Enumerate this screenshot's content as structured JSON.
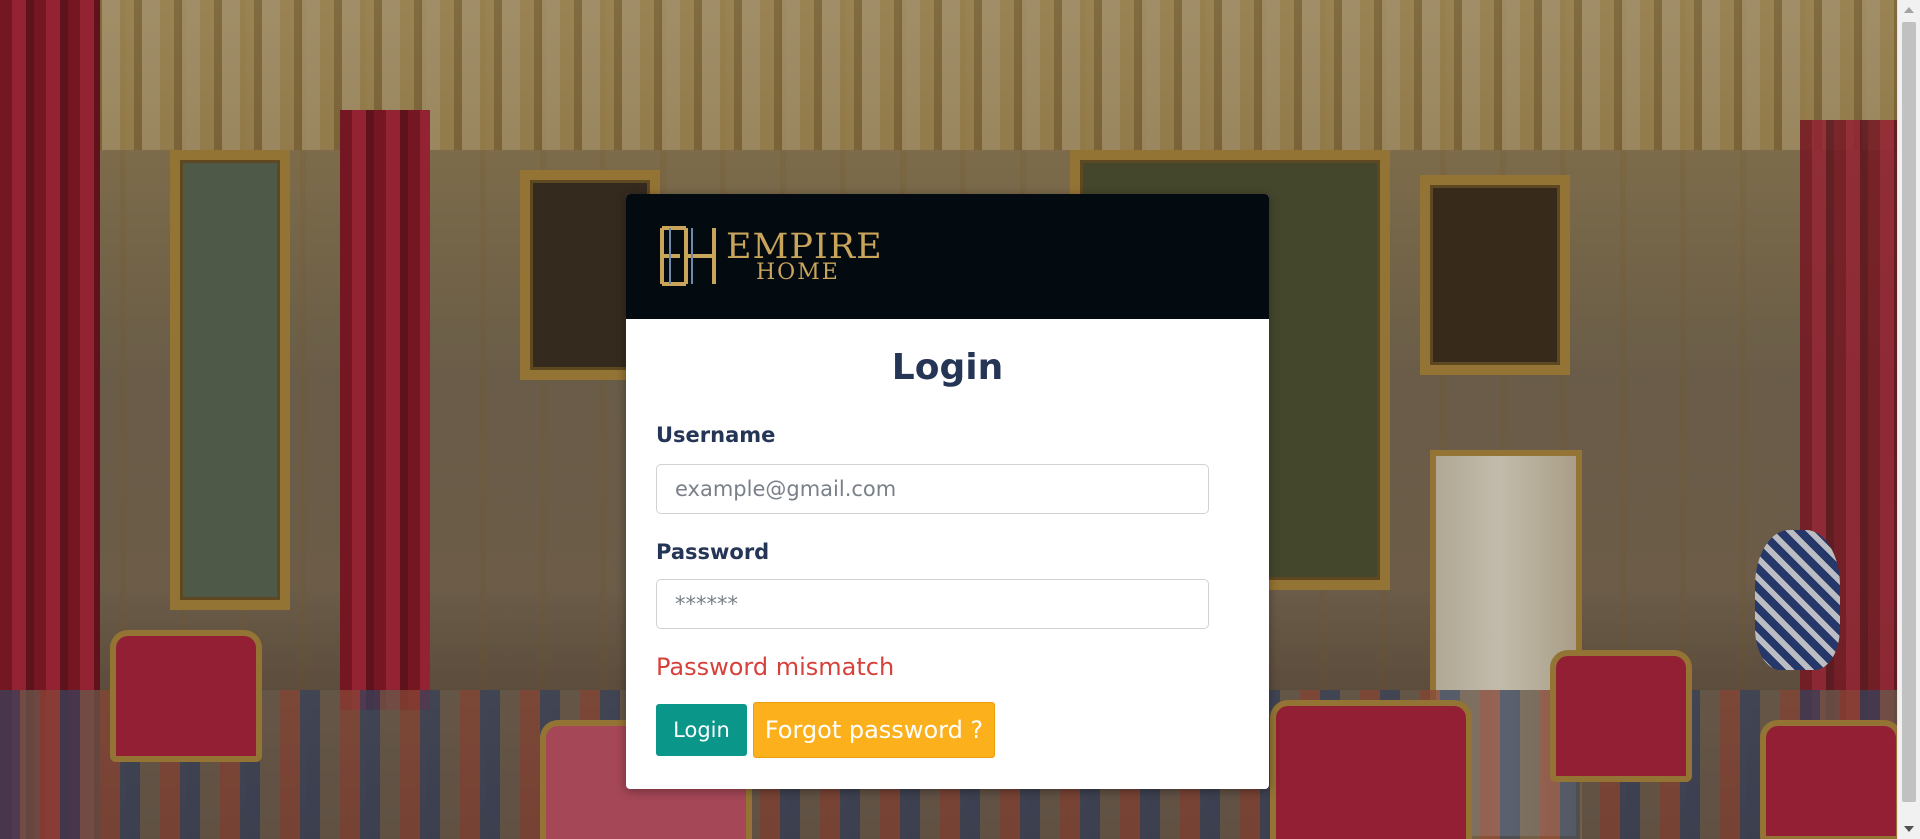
{
  "brand": {
    "word1": "EMPIRE",
    "word2": "HOME",
    "monogram": "EH",
    "color": "#c9a45b",
    "header_bg": "#030b11"
  },
  "login": {
    "title": "Login",
    "username_label": "Username",
    "username_placeholder": "example@gmail.com",
    "password_label": "Password",
    "password_placeholder": "******",
    "error_message": "Password mismatch",
    "login_button": "Login",
    "forgot_button": "Forgot password ?"
  },
  "colors": {
    "title": "#253556",
    "error": "#d6413b",
    "login_button": "#0b968a",
    "forgot_button": "#fbb01c"
  },
  "icons": {
    "scroll_up": "triangle-up",
    "scroll_down": "triangle-down"
  }
}
